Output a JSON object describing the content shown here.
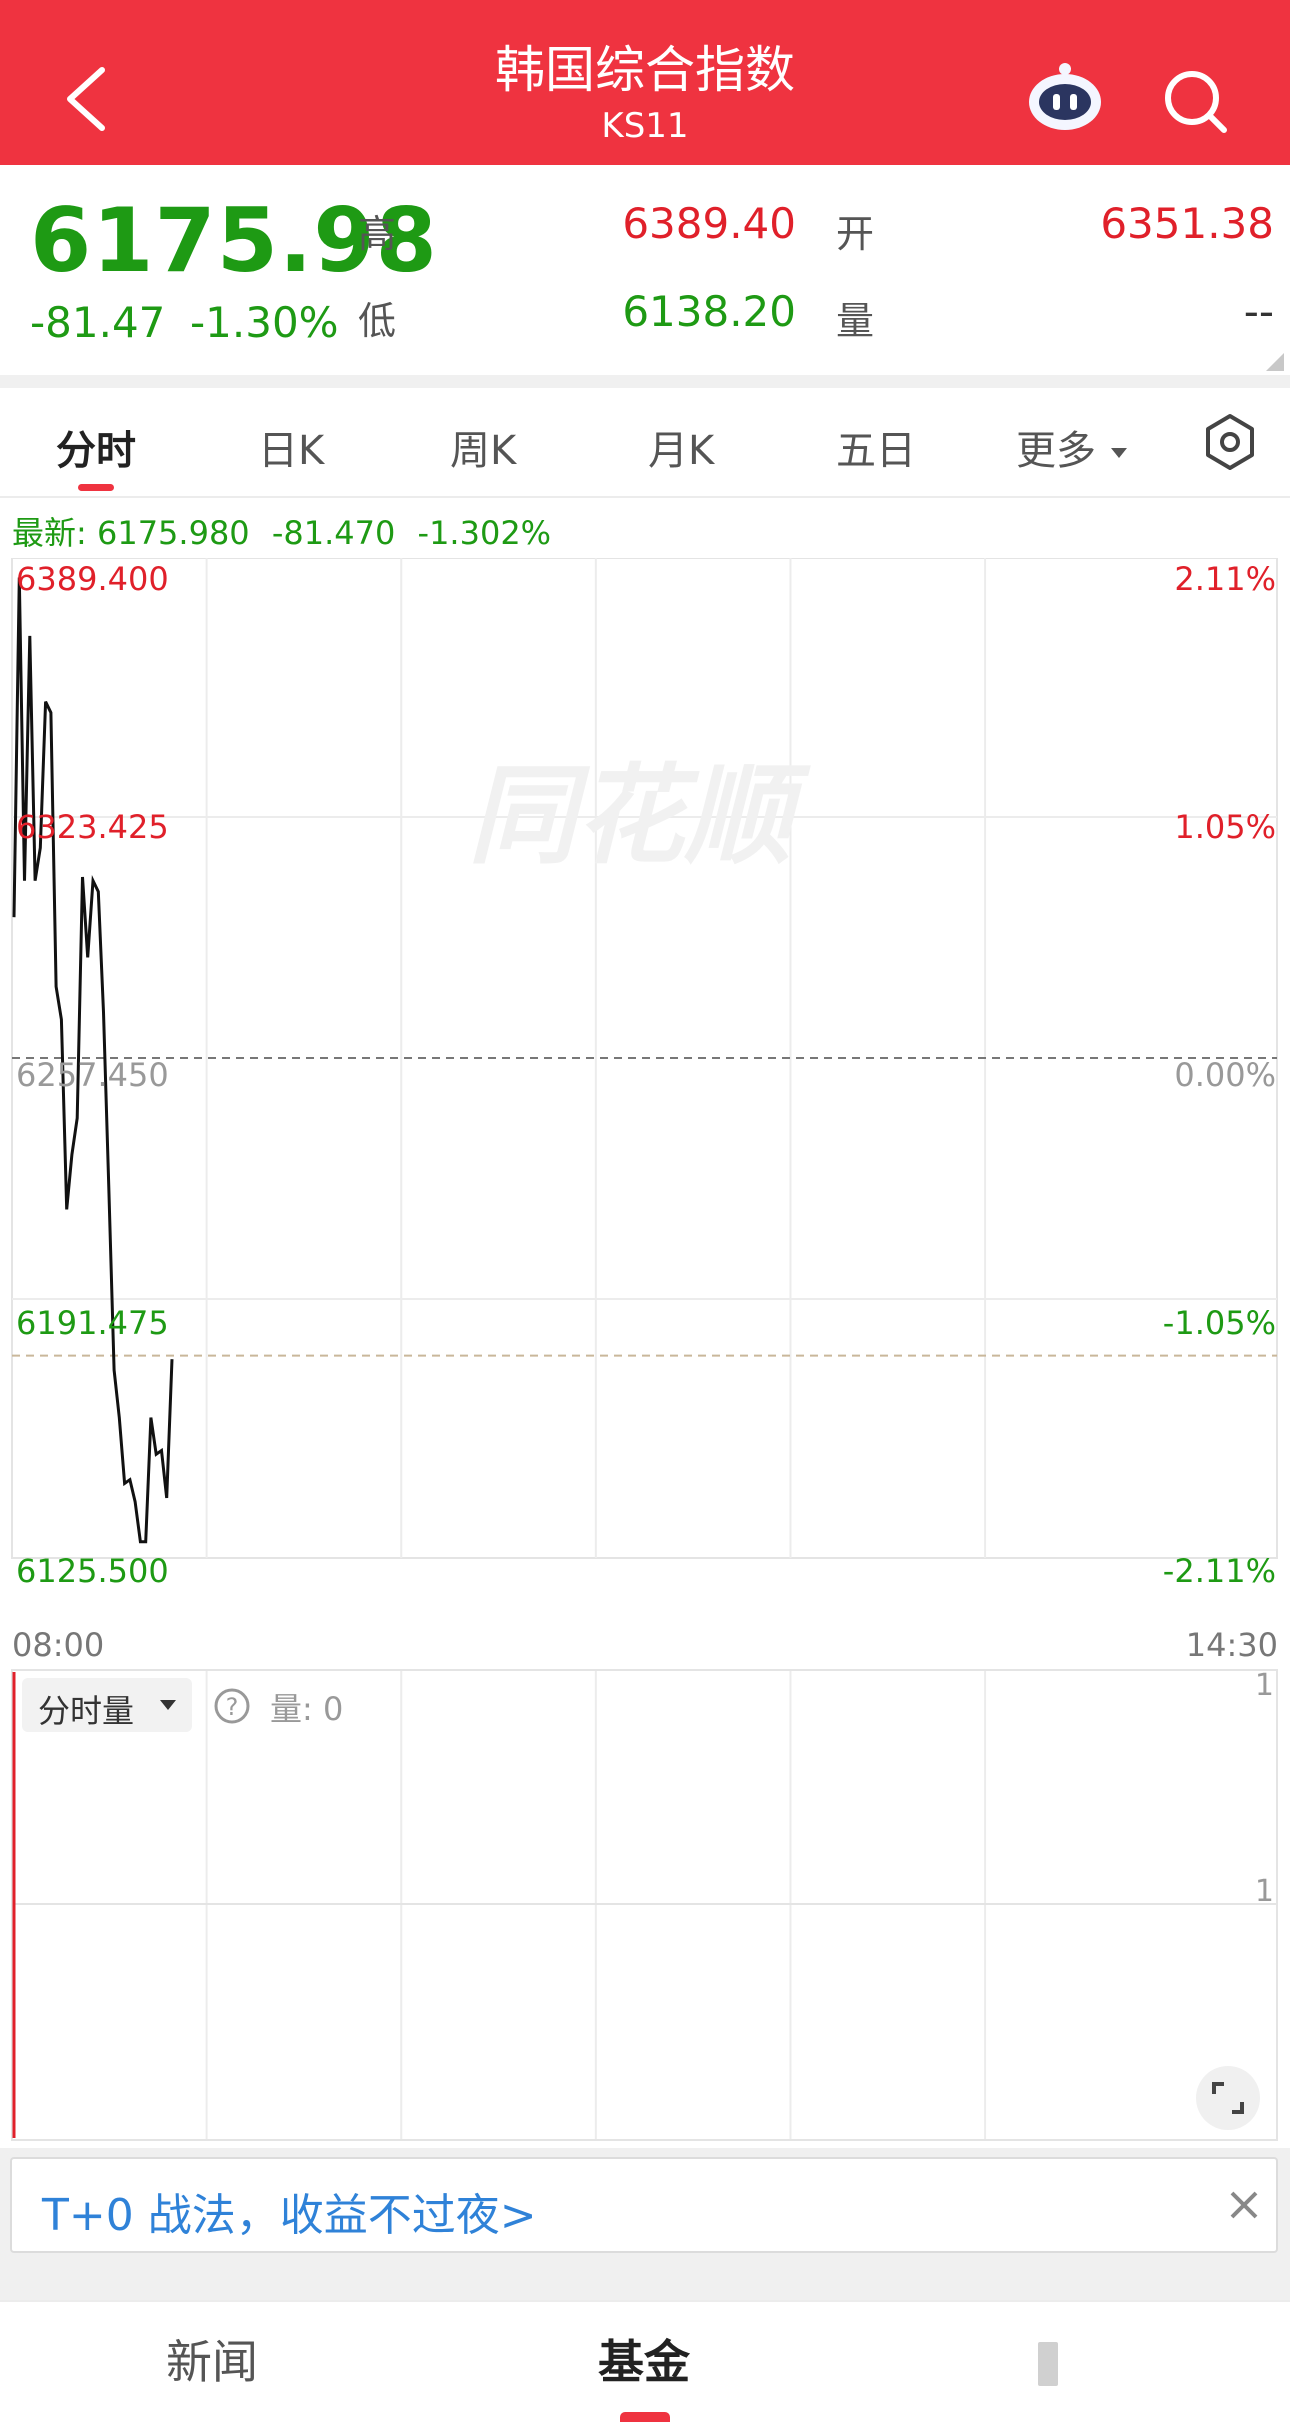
{
  "header": {
    "title": "韩国综合指数",
    "code": "KS11",
    "back_icon": "chevron-left-icon",
    "assistant_icon": "robot-icon",
    "search_icon": "search-icon"
  },
  "quote": {
    "price": "6175.98",
    "change": "-81.47",
    "change_pct": "-1.30%",
    "high_label": "高",
    "high": "6389.40",
    "low_label": "低",
    "low": "6138.20",
    "open_label": "开",
    "open": "6351.38",
    "volume_label": "量",
    "volume": "--",
    "color_up": "#e0202a",
    "color_down": "#1e9a14"
  },
  "tabs": [
    "分时",
    "日K",
    "周K",
    "月K",
    "五日",
    "更多"
  ],
  "tabs_active": "分时",
  "latest": {
    "label": "最新:",
    "value": "6175.980",
    "change": "-81.470",
    "pct": "-1.302%"
  },
  "watermark": "同花顺",
  "chart_data": {
    "type": "line",
    "y_ticks": [
      "6389.400",
      "6323.425",
      "6257.450",
      "6191.475",
      "6125.500"
    ],
    "pct_ticks": [
      "2.11%",
      "1.05%",
      "0.00%",
      "-1.05%",
      "-2.11%"
    ],
    "ylim": [
      6125.5,
      6389.4
    ],
    "base": 6257.45,
    "last": 6175.98,
    "x_labels": [
      "08:00",
      "14:30"
    ],
    "points": [
      [
        0,
        6296
      ],
      [
        1,
        6389
      ],
      [
        2,
        6306
      ],
      [
        3,
        6373
      ],
      [
        4,
        6306
      ],
      [
        5,
        6315
      ],
      [
        6,
        6355
      ],
      [
        7,
        6352
      ],
      [
        8,
        6277
      ],
      [
        9,
        6268
      ],
      [
        10,
        6216
      ],
      [
        11,
        6231
      ],
      [
        12,
        6241
      ],
      [
        13,
        6307
      ],
      [
        14,
        6285
      ],
      [
        15,
        6306
      ],
      [
        16,
        6303
      ],
      [
        17,
        6270
      ],
      [
        18,
        6222
      ],
      [
        19,
        6172
      ],
      [
        20,
        6159
      ],
      [
        21,
        6141
      ],
      [
        22,
        6142
      ],
      [
        23,
        6136
      ],
      [
        24,
        6125
      ],
      [
        25,
        6125
      ],
      [
        26,
        6159
      ],
      [
        27,
        6149
      ],
      [
        28,
        6150
      ],
      [
        29,
        6137
      ],
      [
        30,
        6175
      ]
    ]
  },
  "volume_panel": {
    "selector_label": "分时量",
    "help_icon": "question-icon",
    "label": "量:",
    "value": "0",
    "scale_top": "1",
    "scale_mid": "1",
    "expand_icon": "expand-icon"
  },
  "banner": {
    "text": "T+0 战法，收益不过夜>",
    "close_icon": "close-icon"
  },
  "bottom_nav": [
    "新闻",
    "基金"
  ],
  "bottom_nav_active": "基金"
}
